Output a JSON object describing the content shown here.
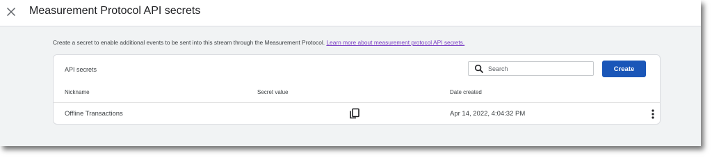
{
  "header": {
    "title": "Measurement Protocol API secrets",
    "close_icon": "close-icon"
  },
  "info": {
    "text": "Create a secret to enable additional events to be sent into this stream through the Measurement Protocol. ",
    "link_text": "Learn more about measurement protocol API secrets."
  },
  "card": {
    "title": "API secrets",
    "search": {
      "placeholder": "Search",
      "value": "",
      "icon": "search-icon"
    },
    "create_label": "Create",
    "columns": [
      "Nickname",
      "Secret value",
      "Date created"
    ],
    "rows": [
      {
        "nickname": "Offline Transactions",
        "secret_icon": "copy-icon",
        "date_created": "Apr 14, 2022, 4:04:32 PM",
        "menu_icon": "more-vert-icon"
      }
    ]
  },
  "colors": {
    "primary": "#1a56b8",
    "link": "#7b3fc4",
    "background": "#f1f3f4"
  }
}
